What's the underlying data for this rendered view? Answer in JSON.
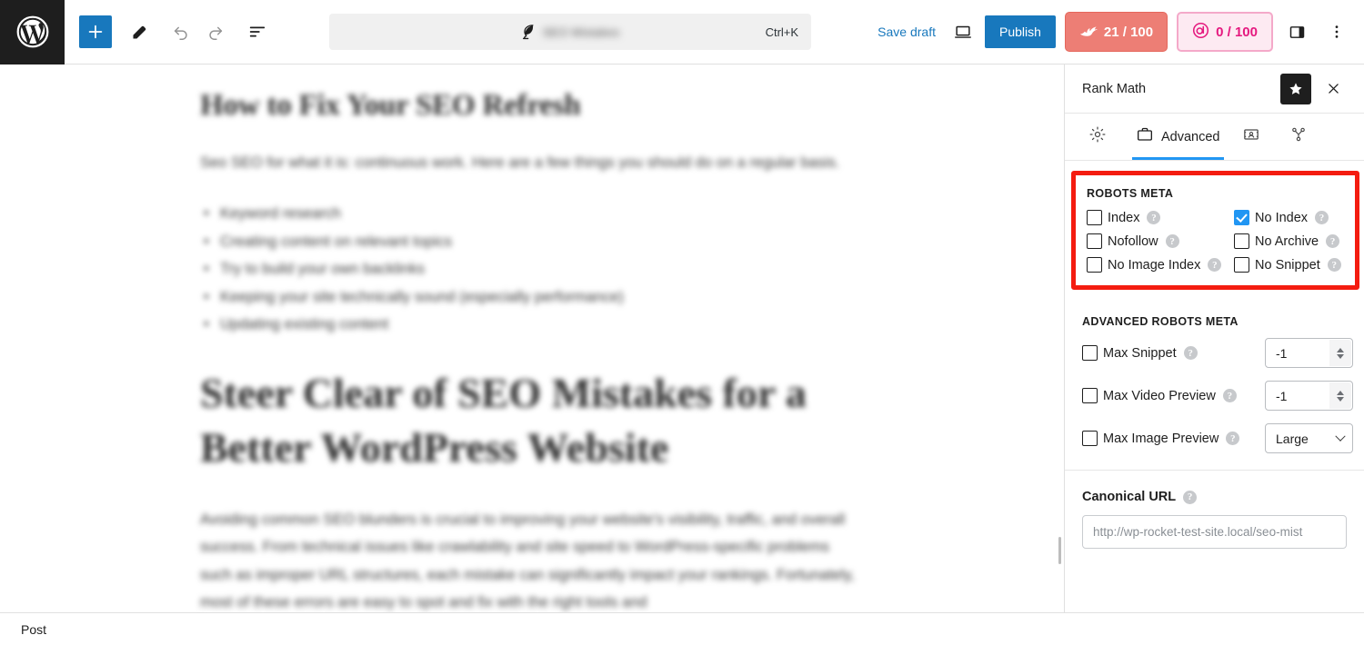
{
  "window": {
    "footer_label": "Post"
  },
  "toolbar": {
    "logo_icon": "wordpress-logo-icon",
    "add_block_icon": "plus-icon",
    "tools_icon": "pencil-icon",
    "undo_icon": "undo-arrow-icon",
    "redo_icon": "redo-arrow-icon",
    "list_view_icon": "document-overview-icon",
    "command_bar": {
      "doc_icon": "leaf-icon",
      "title": "SEO Mistakes",
      "shortcut": "Ctrl+K"
    },
    "save_draft_label": "Save draft",
    "preview_icon": "device-preview-icon",
    "publish_label": "Publish",
    "seo_score": {
      "icon": "rank-math-icon",
      "label": "21 / 100"
    },
    "content_ai_score": {
      "icon": "content-ai-icon",
      "label": "0 / 100"
    },
    "settings_sidebar_icon": "sidebar-panel-icon",
    "options_icon": "three-dots-vertical-icon"
  },
  "editor": {
    "heading_1": "How to Fix Your SEO Refresh",
    "paragraph_1": "Seo SEO for what it is: continuous work. Here are a few things you should do on a regular basis.",
    "list_items": [
      "Keyword research",
      "Creating content on relevant topics",
      "Try to build your own backlinks",
      "Keeping your site technically sound (especially performance)",
      "Updating existing content"
    ],
    "heading_2": "Steer Clear of SEO Mistakes for a Better WordPress Website",
    "paragraph_2": "Avoiding common SEO blunders is crucial to improving your website's visibility, traffic, and overall success. From technical issues like crawlability and site speed to WordPress-specific problems such as improper URL structures, each mistake can significantly impact your rankings. Fortunately, most of these errors are easy to spot and fix with the right tools and"
  },
  "rank_math": {
    "panel_title": "Rank Math",
    "star_icon": "star-icon",
    "close_icon": "close-icon",
    "tabs": [
      {
        "label": "",
        "icon": "gear-icon",
        "name": "general",
        "active": false
      },
      {
        "label": "Advanced",
        "icon": "briefcase-icon",
        "name": "advanced",
        "active": true
      },
      {
        "label": "",
        "icon": "social-card-icon",
        "name": "social",
        "active": false
      },
      {
        "label": "",
        "icon": "schema-node-icon",
        "name": "schema",
        "active": false
      }
    ],
    "highlight_color": "#f41c10",
    "accent_color": "#2196f3",
    "robots_meta": {
      "section_title": "Robots Meta",
      "help_icon": "help-icon",
      "options": [
        {
          "label": "Index",
          "checked": false
        },
        {
          "label": "No Index",
          "checked": true
        },
        {
          "label": "Nofollow",
          "checked": false
        },
        {
          "label": "No Archive",
          "checked": false
        },
        {
          "label": "No Image Index",
          "checked": false
        },
        {
          "label": "No Snippet",
          "checked": false
        }
      ]
    },
    "advanced_robots_meta": {
      "section_title": "Advanced Robots Meta",
      "rows": [
        {
          "label": "Max Snippet",
          "checked": false,
          "control": "spinner",
          "value": "-1"
        },
        {
          "label": "Max Video Preview",
          "checked": false,
          "control": "spinner",
          "value": "-1"
        },
        {
          "label": "Max Image Preview",
          "checked": false,
          "control": "select",
          "value": "Large"
        }
      ]
    },
    "canonical": {
      "label": "Canonical URL",
      "placeholder": "http://wp-rocket-test-site.local/seo-mist"
    }
  }
}
